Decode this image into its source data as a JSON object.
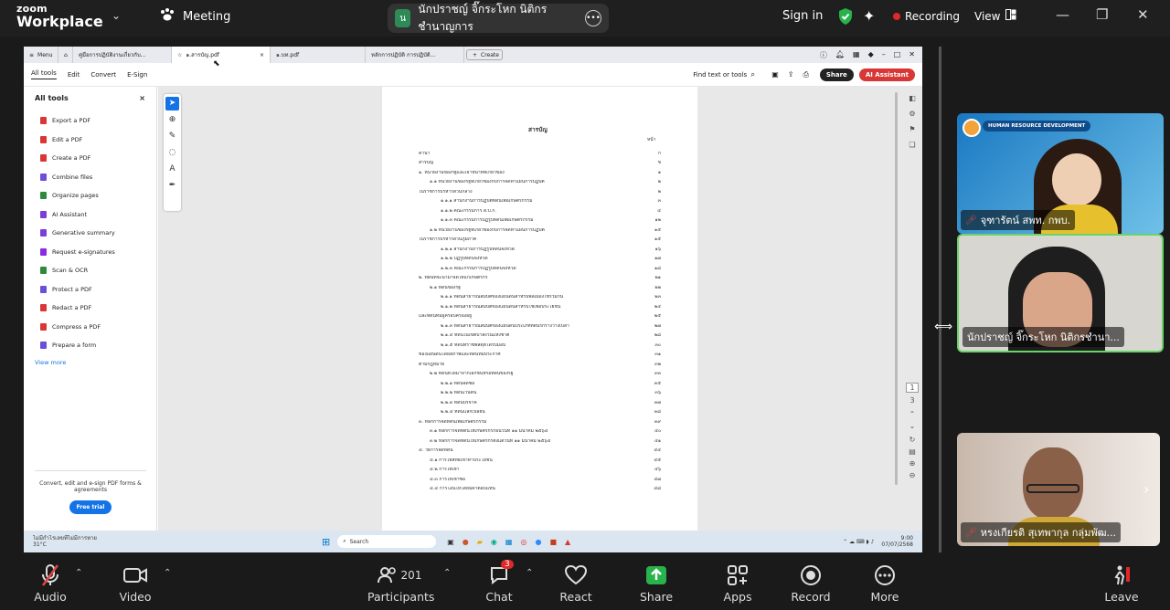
{
  "app": {
    "brand_top": "zoom",
    "brand_bottom": "Workplace",
    "meeting_label": "Meeting",
    "meeting_host": "นักปราชญ์ จิ๊กระโหก นิติกรชำนาญการ",
    "meeting_host_initial": "น",
    "sign_in": "Sign in",
    "recording": "Recording",
    "view": "View"
  },
  "acrobat": {
    "tabs": [
      "Menu",
      "คู่มือการปฏิบัติงานเกี่ยวกับ...",
      "๑.สารบัญ.pdf",
      "๑.บท.pdf",
      "หลักการปฏิบัติ การปฏิบัติ...",
      "Create"
    ],
    "menu": {
      "all_tools": "All tools",
      "edit": "Edit",
      "convert": "Convert",
      "esign": "E-Sign",
      "find": "Find text or tools",
      "share": "Share",
      "ai": "AI Assistant"
    },
    "panel_title": "All tools",
    "tools": [
      "Export a PDF",
      "Edit a PDF",
      "Create a PDF",
      "Combine files",
      "Organize pages",
      "AI Assistant",
      "Generative summary",
      "Request e-signatures",
      "Scan & OCR",
      "Protect a PDF",
      "Redact a PDF",
      "Compress a PDF",
      "Prepare a form"
    ],
    "view_more": "View more",
    "promo": "Convert, edit and e-sign PDF forms & agreements",
    "free_trial": "Free trial",
    "page_number": "1",
    "page_total": "3"
  },
  "doc": {
    "title": "สารบัญ",
    "page_header": "หน้า",
    "lines": [
      {
        "t": "คำนำ",
        "p": "ก"
      },
      {
        "t": "สารบัญ",
        "p": "ข"
      },
      {
        "t": "๑. หน่วยงานของรัฐและเจ้าหน้าที่ที่เกี่ยวข้อง",
        "p": "๑"
      },
      {
        "t": "๑.๑ หน่วยงานของรัฐที่เกี่ยวข้องกับการจัดทำแผนการปฏิบัติ",
        "p": "๒"
      },
      {
        "t": "ในราชการบริหารส่วนกลาง",
        "p": "๒"
      },
      {
        "t": "๑.๑.๑ สำนักงานการปฏิบัติที่ดินเพื่อเกษตรกรรม",
        "p": "๓"
      },
      {
        "t": "๑.๑.๒ คณะกรรมการ ส.ป.ก.",
        "p": "๔"
      },
      {
        "t": "๑.๑.๓ คณะกรรมการปฏิรูปที่ดินเพื่อเกษตรกรรม",
        "p": "๑๒"
      },
      {
        "t": "๑.๒ หน่วยงานของรัฐที่เกี่ยวข้องกับการจัดทำแผนการปฏิบัติ",
        "p": "๑๕"
      },
      {
        "t": "ในราชการบริหารส่วนภูมิภาค",
        "p": "๑๕"
      },
      {
        "t": "๑.๒.๑ สำนักงานการปฏิรูปที่ดินจังหวัด",
        "p": "๑๖"
      },
      {
        "t": "๑.๒.๒ ปฏิรูปที่ดินจังหวัด",
        "p": "๑๗"
      },
      {
        "t": "๑.๒.๓ คณะกรรมการปฏิรูปที่ดินจังหวัด",
        "p": "๑๘"
      },
      {
        "t": "๒. ที่ดินที่จะนำมาจัดให้แก่เกษตรกร",
        "p": "๒๑"
      },
      {
        "t": "๒.๑ ที่ดินของรัฐ",
        "p": "๒๒"
      },
      {
        "t": "๒.๑.๑ ที่ดินสาธารณสมบัติของแผ่นดินสำหรับพลเมืองใช้ร่วมกัน",
        "p": "๒๓"
      },
      {
        "t": "๒.๑.๒ ที่ดินสาธารณสมบัติของแผ่นดินสำหรับใช้เพื่อประโยชน์",
        "p": "๒๔"
      },
      {
        "t": "และที่ดินที่มีผู้ครอบครองอยู่",
        "p": "๒๕"
      },
      {
        "t": "๒.๑.๓ ที่ดินสาธารณสมบัติของแผ่นดินประเภทที่ดินรกร้างว่างเปล่า",
        "p": "๒๗"
      },
      {
        "t": "๒.๑.๔ ที่ดินในเขตป่าสงวนแห่งชาติ",
        "p": "๒๘"
      },
      {
        "t": "๒.๑.๕ ที่ดินที่ราชพัสดุที่ได้รับมอบ",
        "p": "๓๐"
      },
      {
        "t": "ของแผ่นดินโดยสภาพและที่ดินที่มีประกาศ",
        "p": "๓๑"
      },
      {
        "t": "ตามกฎหมาย",
        "p": "๓๒"
      },
      {
        "t": "๒.๒ ที่ดินที่ได้มาจากเอกชนหรือที่ดินของรัฐ",
        "p": "๓๓"
      },
      {
        "t": "๒.๒.๑ ที่ดินจัดซื้อ",
        "p": "๓๕"
      },
      {
        "t": "๒.๒.๒ ที่ดินเวนคืน",
        "p": "๓๖"
      },
      {
        "t": "๒.๒.๓ ที่ดินบริจาค",
        "p": "๓๗"
      },
      {
        "t": "๒.๒.๔ ที่ดินแลกเปลี่ยน",
        "p": "๓๘"
      },
      {
        "t": "๓. หลักการจัดที่ดินเพื่อเกษตรกรรม",
        "p": "๓๙"
      },
      {
        "t": "๓.๑ หลักการจัดที่ดินให้เกษตรกรก่อนวันที่ ๑๑ มีนาคม ๒๕๖๔",
        "p": "๔๐"
      },
      {
        "t": "๓.๒ หลักการจัดที่ดินให้เกษตรกรตั้งแต่วันที่ ๑๑ มีนาคม ๒๕๖๔",
        "p": "๔๑"
      },
      {
        "t": "๔. วิธีการจัดที่ดิน",
        "p": "๔๔"
      },
      {
        "t": "๔.๑ การให้สิทธิเข้าทำประโยชน์",
        "p": "๔๕"
      },
      {
        "t": "๔.๒ การให้เช่า",
        "p": "๔๖"
      },
      {
        "t": "๔.๓ การให้เช่าซื้อ",
        "p": "๔๗"
      },
      {
        "t": "๔.๔ การโอนให้โดยมีค่าตอบแทน",
        "p": "๔๘"
      }
    ]
  },
  "taskbar": {
    "weather_title": "ไม่มีกำไรเลขที่ไม่มีการหาย...",
    "weather_temp": "31°C",
    "search": "Search",
    "time": "9:00",
    "date": "07/07/2568"
  },
  "participants": [
    {
      "name": "จุฑารัตน์ สพท. กพบ.",
      "banner": "HUMAN RESOURCE DEVELOPMENT"
    },
    {
      "name": "นักปราชญ์ จิ๊กระโหก นิติกรชำนา..."
    },
    {
      "name": "หรงเกียรติ สุเทพากุล กลุ่มพัฒ..."
    }
  ],
  "toolbar": {
    "audio": "Audio",
    "video": "Video",
    "participants": "Participants",
    "participant_count": "201",
    "chat": "Chat",
    "chat_badge": "3",
    "react": "React",
    "share": "Share",
    "apps": "Apps",
    "record": "Record",
    "more": "More",
    "leave": "Leave"
  },
  "colors": {
    "zoom_bg": "#1a1a1a",
    "share_green": "#28b24b",
    "record_red": "#e02828",
    "acrobat_red": "#d93636",
    "acrobat_blue": "#1473e6",
    "active_speaker": "#6ad36a"
  }
}
